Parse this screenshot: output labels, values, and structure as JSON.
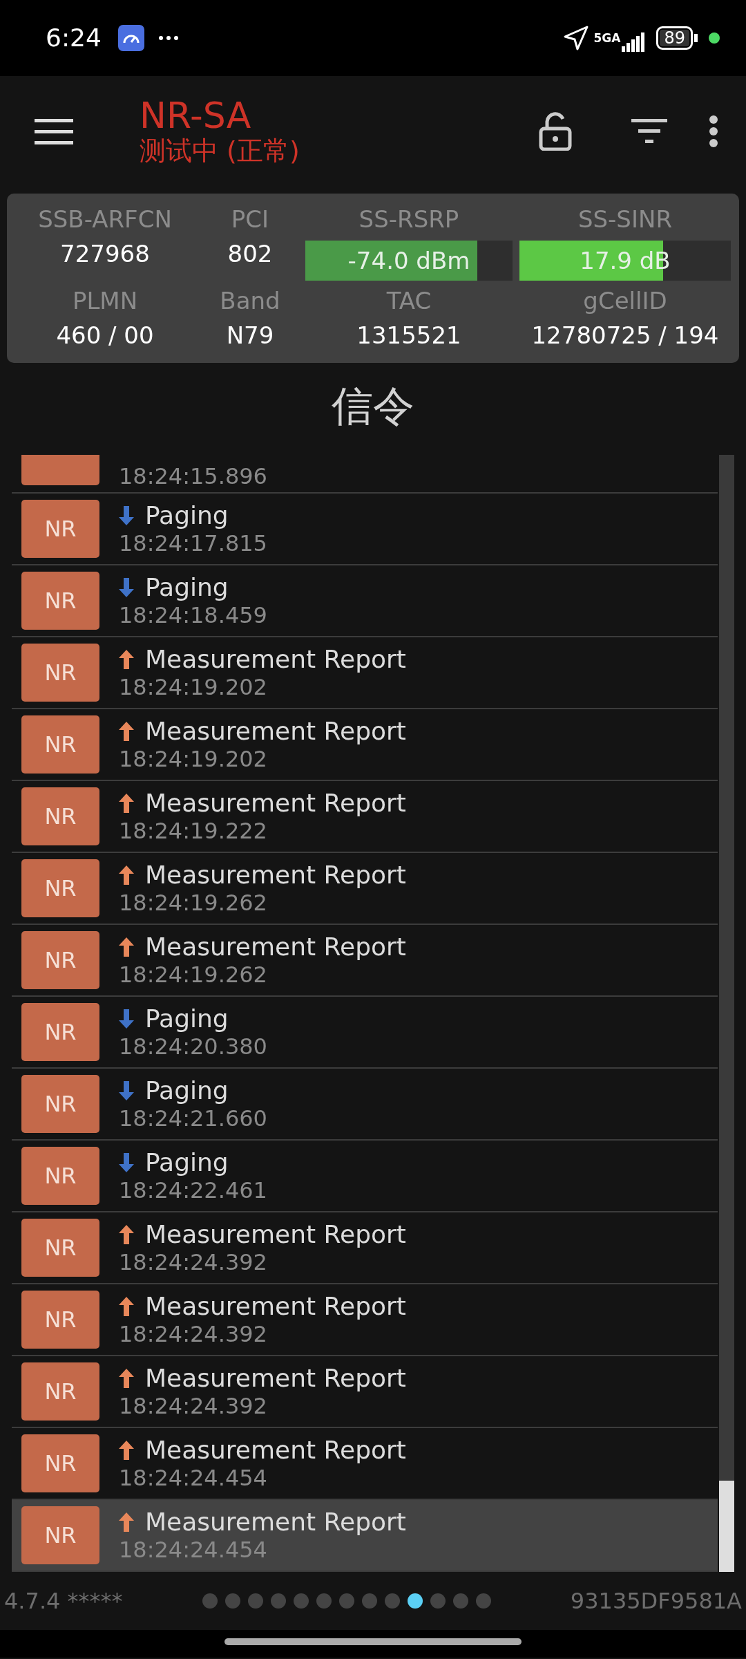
{
  "status_bar": {
    "time": "6:24",
    "network": "5GA",
    "battery": "89"
  },
  "app_bar": {
    "title": "NR-SA",
    "subtitle": "测试中 (正常)"
  },
  "cell_info": [
    {
      "kind": "text",
      "label": "SSB-ARFCN",
      "value": "727968"
    },
    {
      "kind": "text",
      "label": "PCI",
      "value": "802"
    },
    {
      "kind": "meter",
      "label": "SS-RSRP",
      "value": "-74.0 dBm",
      "level": 0.83,
      "color": "#4a9a48"
    },
    {
      "kind": "meter",
      "label": "SS-SINR",
      "value": "17.9 dB",
      "level": 0.68,
      "color": "#5cc845"
    },
    {
      "kind": "text",
      "label": "PLMN",
      "value": "460 / 00"
    },
    {
      "kind": "text",
      "label": "Band",
      "value": "N79"
    },
    {
      "kind": "text",
      "label": "TAC",
      "value": "1315521"
    },
    {
      "kind": "text",
      "label": "gCellID",
      "value": "12780725 / 194"
    }
  ],
  "section_title": "信令",
  "messages": [
    {
      "time": "18:24:15.896",
      "selected": false
    },
    {
      "badge": "NR",
      "kind": "downlink",
      "title": "Paging",
      "time": "18:24:17.815",
      "selected": false
    },
    {
      "badge": "NR",
      "kind": "downlink",
      "title": "Paging",
      "time": "18:24:18.459",
      "selected": false
    },
    {
      "badge": "NR",
      "kind": "uplink",
      "title": "Measurement Report",
      "time": "18:24:19.202",
      "selected": false
    },
    {
      "badge": "NR",
      "kind": "uplink",
      "title": "Measurement Report",
      "time": "18:24:19.202",
      "selected": false
    },
    {
      "badge": "NR",
      "kind": "uplink",
      "title": "Measurement Report",
      "time": "18:24:19.222",
      "selected": false
    },
    {
      "badge": "NR",
      "kind": "uplink",
      "title": "Measurement Report",
      "time": "18:24:19.262",
      "selected": false
    },
    {
      "badge": "NR",
      "kind": "uplink",
      "title": "Measurement Report",
      "time": "18:24:19.262",
      "selected": false
    },
    {
      "badge": "NR",
      "kind": "downlink",
      "title": "Paging",
      "time": "18:24:20.380",
      "selected": false
    },
    {
      "badge": "NR",
      "kind": "downlink",
      "title": "Paging",
      "time": "18:24:21.660",
      "selected": false
    },
    {
      "badge": "NR",
      "kind": "downlink",
      "title": "Paging",
      "time": "18:24:22.461",
      "selected": false
    },
    {
      "badge": "NR",
      "kind": "uplink",
      "title": "Measurement Report",
      "time": "18:24:24.392",
      "selected": false
    },
    {
      "badge": "NR",
      "kind": "uplink",
      "title": "Measurement Report",
      "time": "18:24:24.392",
      "selected": false
    },
    {
      "badge": "NR",
      "kind": "uplink",
      "title": "Measurement Report",
      "time": "18:24:24.392",
      "selected": false
    },
    {
      "badge": "NR",
      "kind": "uplink",
      "title": "Measurement Report",
      "time": "18:24:24.454",
      "selected": false
    },
    {
      "badge": "NR",
      "kind": "uplink",
      "title": "Measurement Report",
      "time": "18:24:24.454",
      "selected": true
    }
  ],
  "footer": {
    "version": "4.7.4 *****",
    "pages": [
      {
        "selected": false
      },
      {
        "selected": false
      },
      {
        "selected": false
      },
      {
        "selected": false
      },
      {
        "selected": false
      },
      {
        "selected": false
      },
      {
        "selected": false
      },
      {
        "selected": false
      },
      {
        "selected": false
      },
      {
        "selected": true
      },
      {
        "selected": false
      },
      {
        "selected": false
      },
      {
        "selected": false
      }
    ],
    "device_id": "93135DF9581A"
  }
}
